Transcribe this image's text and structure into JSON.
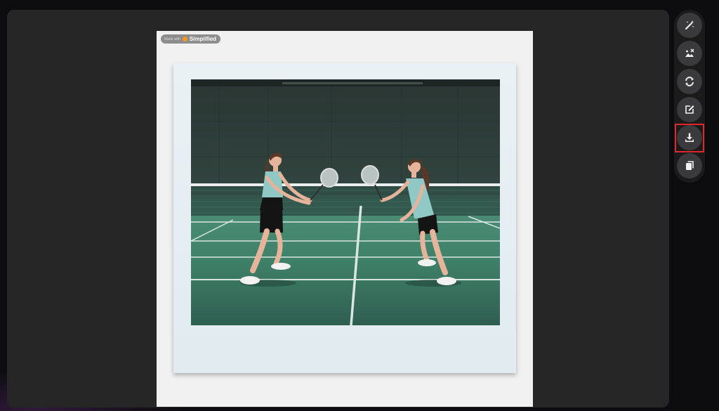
{
  "watermark": {
    "prefix": "Made with",
    "brand": "Simplified"
  },
  "image": {
    "alt": "Two girls playing badminton on an indoor green court"
  },
  "toolbar": {
    "buttons": [
      {
        "name": "magic-edit-button",
        "icon": "magic-wand-icon",
        "title": "Magic edit"
      },
      {
        "name": "remove-background-button",
        "icon": "image-remove-icon",
        "title": "Remove background"
      },
      {
        "name": "regenerate-button",
        "icon": "refresh-icon",
        "title": "Regenerate"
      },
      {
        "name": "edit-button",
        "icon": "edit-icon",
        "title": "Edit"
      },
      {
        "name": "download-button",
        "icon": "download-icon",
        "title": "Download",
        "highlighted": true
      },
      {
        "name": "copy-button",
        "icon": "copy-icon",
        "title": "Copy"
      }
    ]
  },
  "colors": {
    "highlight": "#e0262b",
    "panel": "#262626",
    "button": "#3a3a3c",
    "brand": "#f29a1f"
  }
}
